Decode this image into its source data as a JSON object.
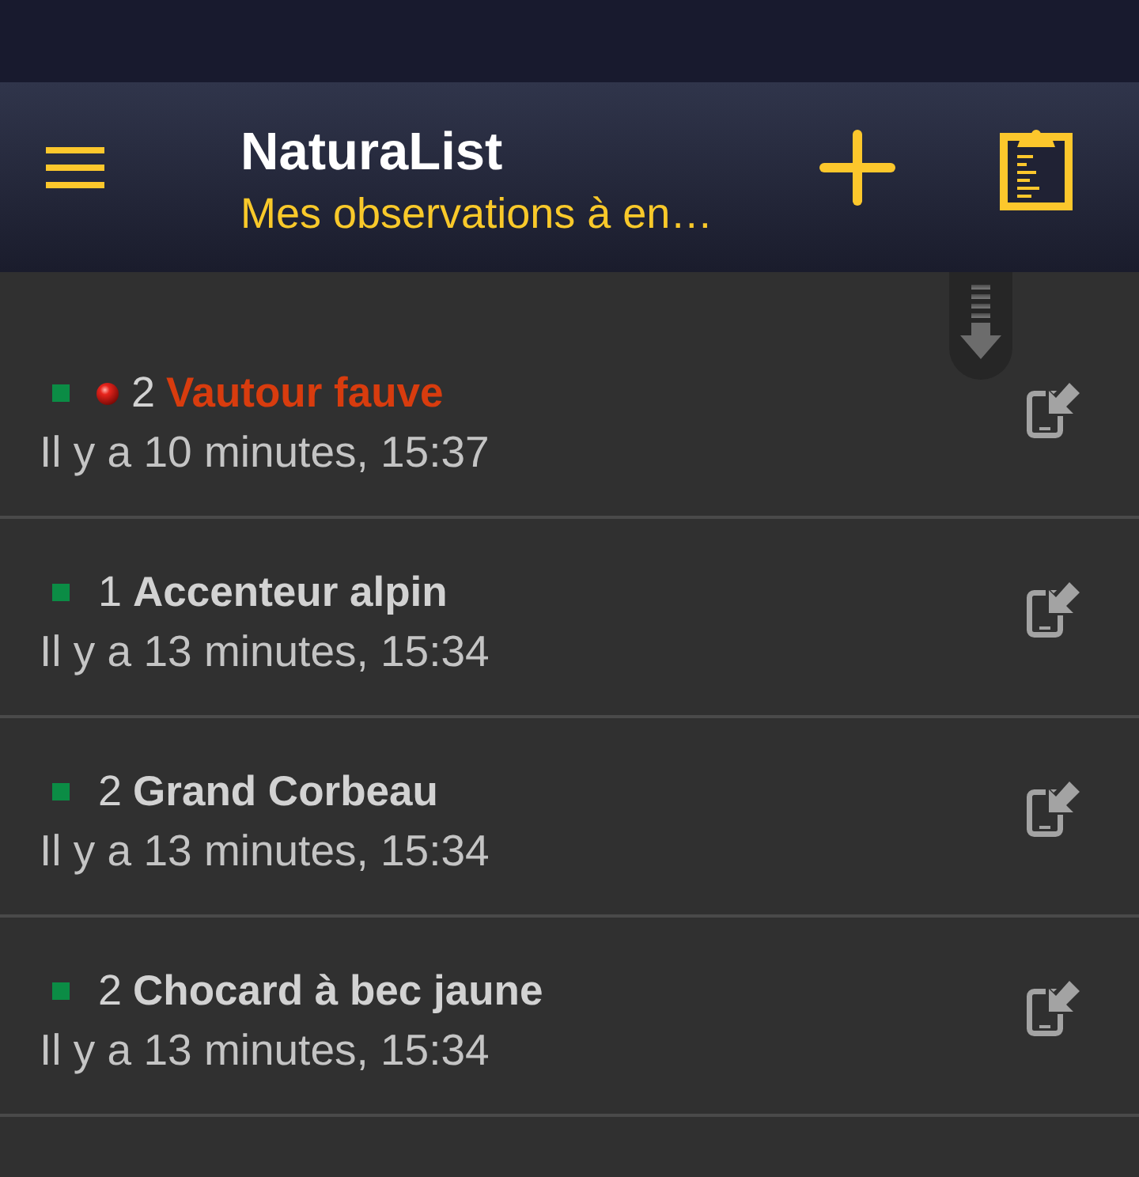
{
  "app_bar": {
    "title": "NaturaList",
    "subtitle": "Mes observations à en…"
  },
  "observations": [
    {
      "color": "#0b8c45",
      "alert": true,
      "count": "2",
      "species": "Vautour fauve",
      "time": "Il y a 10 minutes, 15:37"
    },
    {
      "color": "#0b8c45",
      "alert": false,
      "count": "1",
      "species": "Accenteur alpin",
      "time": "Il y a 13 minutes, 15:34"
    },
    {
      "color": "#0b8c45",
      "alert": false,
      "count": "2",
      "species": "Grand Corbeau",
      "time": "Il y a 13 minutes, 15:34"
    },
    {
      "color": "#0b8c45",
      "alert": false,
      "count": "2",
      "species": "Chocard à bec jaune",
      "time": "Il y a 13 minutes, 15:34"
    }
  ]
}
